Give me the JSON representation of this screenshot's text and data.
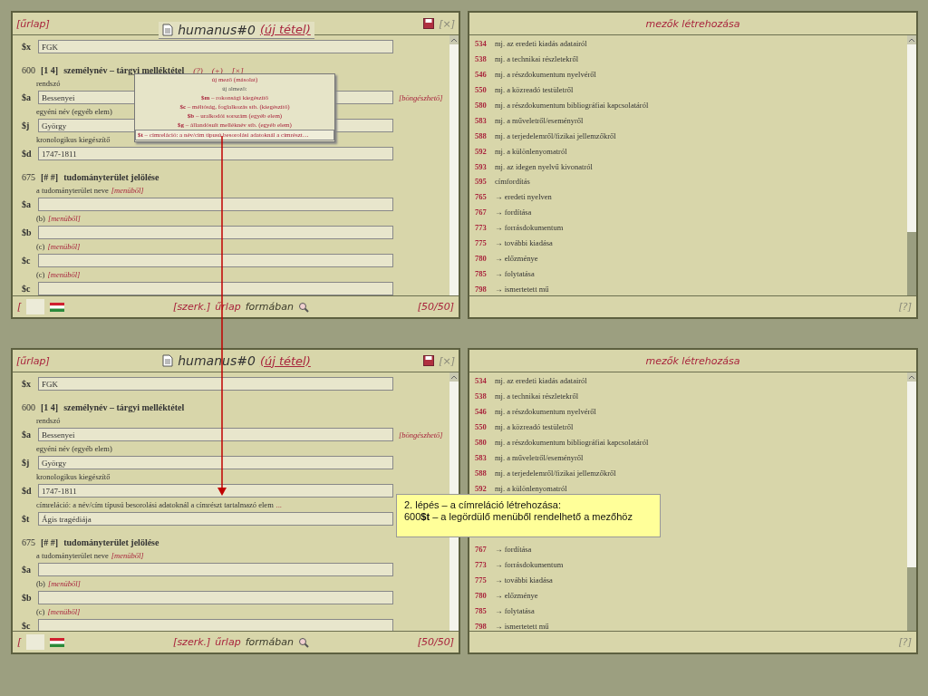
{
  "form_windows": [
    {
      "menu_label": "[űrlap]",
      "title": "humanus#0",
      "status": "(új tétel)",
      "close": "[×]",
      "tab_style": true,
      "rows": [
        {
          "kind": "field",
          "tag": "$x",
          "value": "FGK"
        },
        {
          "kind": "heading",
          "code": "600",
          "indicators": "[1 4]",
          "title": "személynév – tárgyi melléktétel",
          "controls": [
            "(?)",
            "(+)",
            "[×]"
          ]
        },
        {
          "kind": "label",
          "text": "rendszó"
        },
        {
          "kind": "field",
          "tag": "$a",
          "value": "Bessenyei",
          "link": "[böngészhető]"
        },
        {
          "kind": "label",
          "text": "egyéni név (egyéb elem)"
        },
        {
          "kind": "field",
          "tag": "$j",
          "value": "György"
        },
        {
          "kind": "label",
          "text": "kronologikus kiegészítő"
        },
        {
          "kind": "field",
          "tag": "$d",
          "value": "1747-1811"
        },
        {
          "kind": "heading",
          "code": "675",
          "indicators": "[# #]",
          "title": "tudományterület jelölése"
        },
        {
          "kind": "label",
          "text": "a tudományterület neve",
          "hint": "[menüből]"
        },
        {
          "kind": "field",
          "tag": "$a",
          "value": ""
        },
        {
          "kind": "label",
          "text": "(b)",
          "hint": "[menüből]"
        },
        {
          "kind": "field",
          "tag": "$b",
          "value": ""
        },
        {
          "kind": "label",
          "text": "(c)",
          "hint": "[menüből]"
        },
        {
          "kind": "field",
          "tag": "$c",
          "value": ""
        },
        {
          "kind": "label",
          "text": "(c)",
          "hint": "[menüből]"
        },
        {
          "kind": "field",
          "tag": "$c",
          "value": ""
        }
      ],
      "dropdown": {
        "items": [
          {
            "kind": "action",
            "text": "új mező (másolat)",
            "selected": false
          },
          {
            "kind": "caption",
            "text": "új almező:",
            "selected": false
          },
          {
            "kind": "action",
            "text": "**$m** – rokonsági kiegészítő",
            "selected": false
          },
          {
            "kind": "action",
            "text": "**$c** – méltóság, foglalkozás stb. (kiegészítő)",
            "selected": false
          },
          {
            "kind": "action",
            "text": "**$b** – uralkodói sorszám (egyéb elem)",
            "selected": false
          },
          {
            "kind": "action",
            "text": "**$g** – állandósult melléknév stb. (egyéb elem)",
            "selected": false
          },
          {
            "kind": "action",
            "text": "**$t** – címreláció: a név/cím típusú besorolási adatoknál a címrészt…",
            "selected": true
          }
        ]
      },
      "footer": {
        "bracket": "[",
        "edit_link": "[szerk.]",
        "mode": "űrlap",
        "mode_rest": "formában",
        "count": "[50/50]"
      }
    },
    {
      "menu_label": "[űrlap]",
      "title": "humanus#0",
      "status": "(új tétel)",
      "close": "[×]",
      "tab_style": false,
      "rows": [
        {
          "kind": "field",
          "tag": "$x",
          "value": "FGK"
        },
        {
          "kind": "heading",
          "code": "600",
          "indicators": "[1 4]",
          "title": "személynév – tárgyi melléktétel"
        },
        {
          "kind": "label",
          "text": "rendszó"
        },
        {
          "kind": "field",
          "tag": "$a",
          "value": "Bessenyei",
          "link": "[böngészhető]"
        },
        {
          "kind": "label",
          "text": "egyéni név (egyéb elem)"
        },
        {
          "kind": "field",
          "tag": "$j",
          "value": "György"
        },
        {
          "kind": "label",
          "text": "kronologikus kiegészítő"
        },
        {
          "kind": "field",
          "tag": "$d",
          "value": "1747-1811"
        },
        {
          "kind": "label",
          "text": "címreláció: a név/cím típusú besorolási adatoknál a címrészt tartalmazó elem",
          "hint": "..."
        },
        {
          "kind": "field",
          "tag": "$t",
          "value": "Ágis tragédiája"
        },
        {
          "kind": "heading",
          "code": "675",
          "indicators": "[# #]",
          "title": "tudományterület jelölése"
        },
        {
          "kind": "label",
          "text": "a tudományterület neve",
          "hint": "[menüből]"
        },
        {
          "kind": "field",
          "tag": "$a",
          "value": ""
        },
        {
          "kind": "label",
          "text": "(b)",
          "hint": "[menüből]"
        },
        {
          "kind": "field",
          "tag": "$b",
          "value": ""
        },
        {
          "kind": "label",
          "text": "(c)",
          "hint": "[menüből]"
        },
        {
          "kind": "field",
          "tag": "$c",
          "value": ""
        }
      ],
      "footer": {
        "bracket": "[",
        "edit_link": "[szerk.]",
        "mode": "űrlap",
        "mode_rest": "formában",
        "count": "[50/50]"
      }
    }
  ],
  "field_windows": [
    {
      "title": "mezők létrehozása",
      "help": "[?]",
      "items_above": [
        {
          "code": "534",
          "text": "mj. az eredeti kiadás adatairól"
        },
        {
          "code": "538",
          "text": "mj. a technikai részletekről"
        },
        {
          "code": "546",
          "text": "mj. a részdokumentum nyelvéről"
        },
        {
          "code": "550",
          "text": "mj. a közreadó testületről"
        },
        {
          "code": "580",
          "text": "mj. a részdokumentum bibliográfiai kapcsolatáról"
        },
        {
          "code": "583",
          "text": "mj. a műveletről/eseményről"
        },
        {
          "code": "588",
          "text": "mj. a terjedelemről/fizikai jellemzőkről"
        },
        {
          "code": "592",
          "text": "mj. a különlenyomatról"
        },
        {
          "code": "593",
          "text": "mj. az idegen nyelvű kivonatról"
        },
        {
          "code": "595",
          "text": "címfordítás"
        },
        {
          "code": "765",
          "text": "→ eredeti nyelven"
        },
        {
          "code": "767",
          "text": "→ fordítása"
        },
        {
          "code": "773",
          "text": "→ forrásdokumentum"
        },
        {
          "code": "775",
          "text": "→ további kiadása"
        },
        {
          "code": "780",
          "text": "→ előzménye"
        },
        {
          "code": "785",
          "text": "→ folytatása"
        },
        {
          "code": "798",
          "text": "→ ismertetett mű"
        }
      ]
    },
    {
      "title": "mezők létrehozása",
      "help": "[?]",
      "items_above": [
        {
          "code": "534",
          "text": "mj. az eredeti kiadás adatairól"
        },
        {
          "code": "538",
          "text": "mj. a technikai részletekről"
        },
        {
          "code": "546",
          "text": "mj. a részdokumentum nyelvéről"
        },
        {
          "code": "550",
          "text": "mj. a közreadó testületről"
        },
        {
          "code": "580",
          "text": "mj. a részdokumentum bibliográfiai kapcsolatáról"
        },
        {
          "code": "583",
          "text": "mj. a műveletről/eseményről"
        },
        {
          "code": "588",
          "text": "mj. a terjedelemről/fizikai jellemzőkről"
        },
        {
          "code": "592",
          "text": "mj. a különlenyomatról"
        }
      ],
      "items_below": [
        {
          "code": "767",
          "text": "→ fordítása"
        },
        {
          "code": "773",
          "text": "→ forrásdokumentum"
        },
        {
          "code": "775",
          "text": "→ további kiadása"
        },
        {
          "code": "780",
          "text": "→ előzménye"
        },
        {
          "code": "785",
          "text": "→ folytatása"
        },
        {
          "code": "798",
          "text": "→ ismertetett mű"
        }
      ]
    }
  ],
  "callout": {
    "lines": [
      "2. lépés – a címreláció létrehozása:",
      "600**$t** – a legördülő menüből rendelhető a mezőhöz"
    ]
  }
}
